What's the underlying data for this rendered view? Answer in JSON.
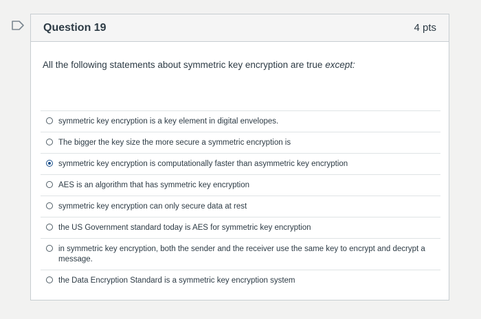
{
  "question": {
    "title": "Question 19",
    "points": "4 pts",
    "prompt_main": "All the following statements about symmetric key encryption are true ",
    "prompt_emph": "except:"
  },
  "answers": [
    {
      "label": "symmetric key encryption is a key element in digital envelopes.",
      "selected": false
    },
    {
      "label": "The bigger the key size the more secure a symmetric encryption is",
      "selected": false
    },
    {
      "label": "symmetric key encryption is computationally faster than asymmetric key encryption",
      "selected": true
    },
    {
      "label": "AES is an algorithm that has symmetric key encryption",
      "selected": false
    },
    {
      "label": "symmetric key encryption can only secure data at rest",
      "selected": false
    },
    {
      "label": "the US Government standard today is AES for symmetric key encryption",
      "selected": false
    },
    {
      "label": "in symmetric key encryption, both the sender and the receiver use the same key to encrypt and decrypt a message.",
      "selected": false
    },
    {
      "label": "the Data Encryption Standard is a symmetric key encryption system",
      "selected": false
    }
  ],
  "colors": {
    "accent": "#1a4f8b",
    "text": "#2d3b45",
    "border": "#c7cdd1"
  },
  "icons": {
    "flag": "flag-icon"
  }
}
